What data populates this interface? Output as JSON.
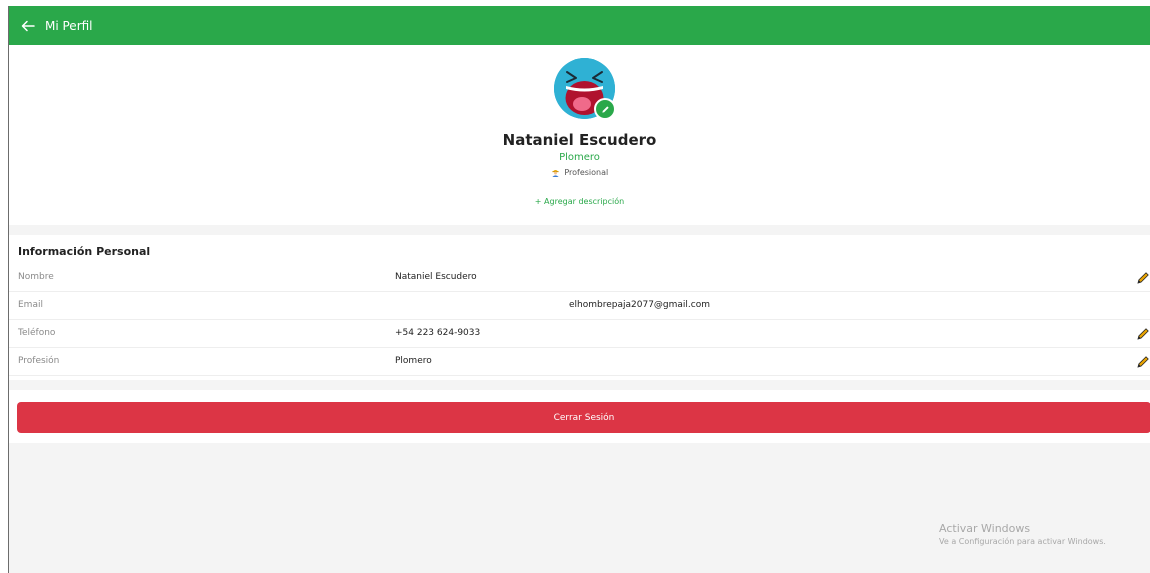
{
  "header": {
    "title": "Mi Perfil",
    "back_icon": "arrow-left-icon",
    "color": "#2aa84a"
  },
  "profile": {
    "name": "Nataniel Escudero",
    "profession": "Plomero",
    "role": "Profesional",
    "add_description": "+ Agregar descripción",
    "avatar_color": "#2fb1d4"
  },
  "info": {
    "title": "Información Personal",
    "rows": [
      {
        "label": "Nombre",
        "value": "Nataniel Escudero",
        "editable": true
      },
      {
        "label": "Email",
        "value": "elhombrepaja2077@gmail.com",
        "editable": false
      },
      {
        "label": "Teléfono",
        "value": "+54 223 624-9033",
        "editable": true
      },
      {
        "label": "Profesión",
        "value": "Plomero",
        "editable": true
      }
    ]
  },
  "logout": {
    "label": "Cerrar Sesión",
    "color": "#dc3545"
  },
  "watermark": {
    "line1": "Activar Windows",
    "line2": "Ve a Configuración para activar Windows."
  }
}
